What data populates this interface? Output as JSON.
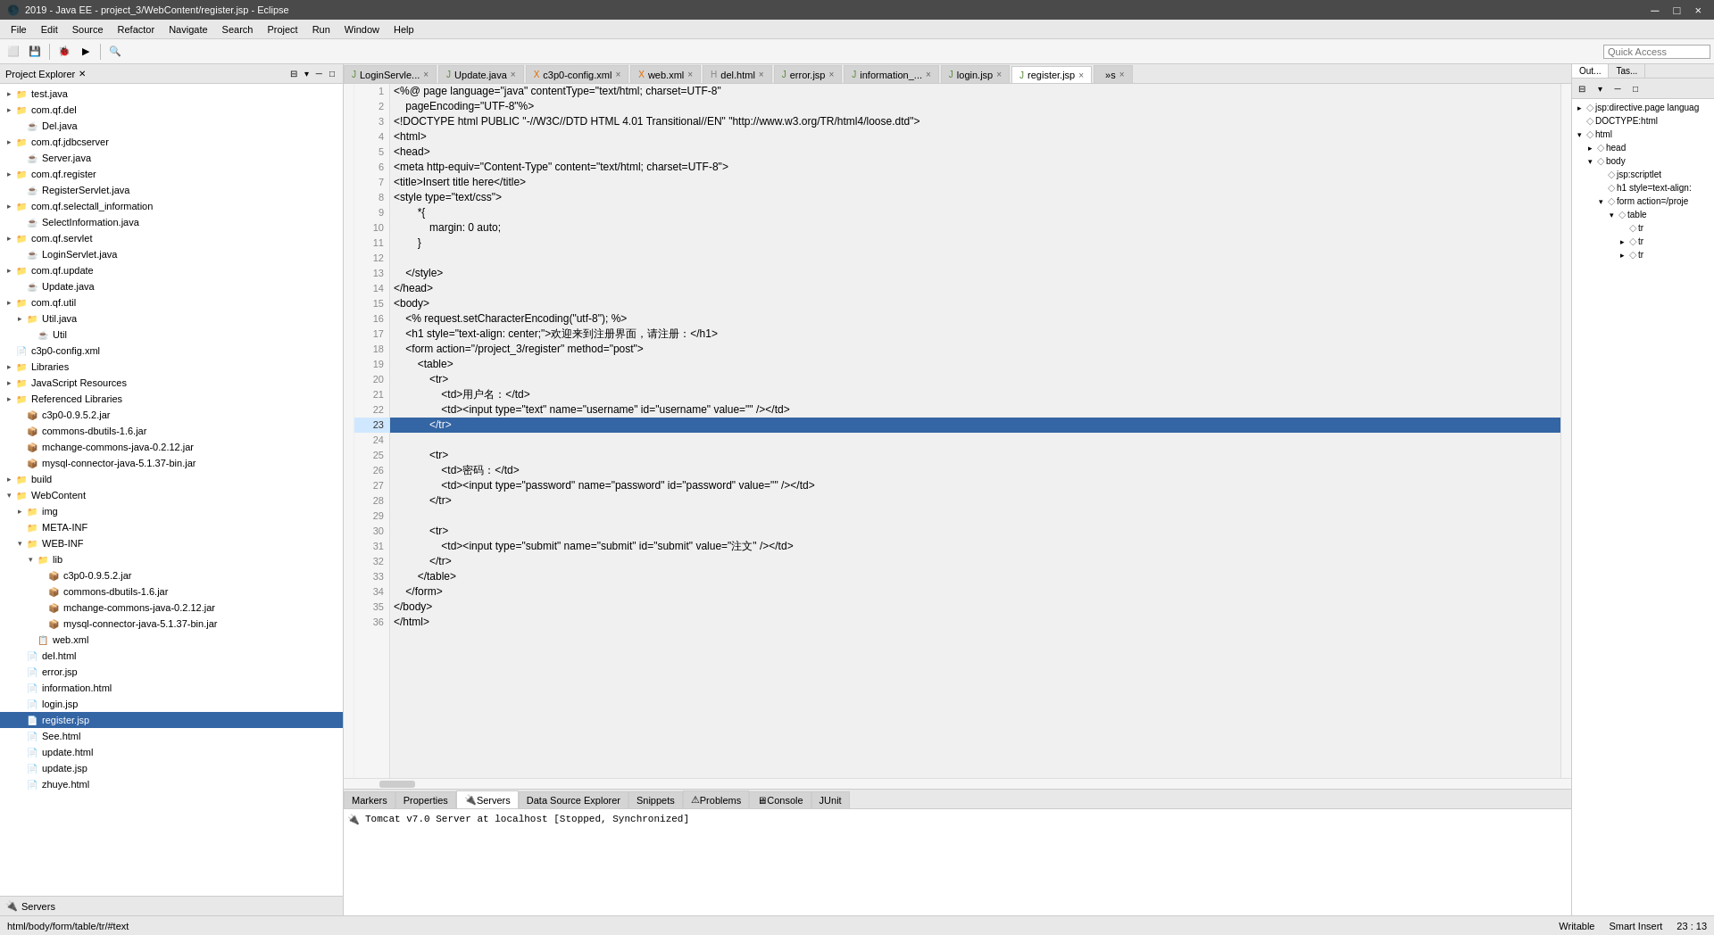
{
  "window": {
    "title": "2019 - Java EE - project_3/WebContent/register.jsp - Eclipse",
    "minimize": "─",
    "maximize": "□",
    "close": "×"
  },
  "menubar": {
    "items": [
      "File",
      "Edit",
      "Source",
      "Refactor",
      "Navigate",
      "Search",
      "Project",
      "Run",
      "Window",
      "Help"
    ]
  },
  "tabs": [
    {
      "label": "LoginServle...",
      "active": false,
      "icon": "J"
    },
    {
      "label": "Update.java",
      "active": false,
      "icon": "J"
    },
    {
      "label": "c3p0-config.xml",
      "active": false,
      "icon": "X"
    },
    {
      "label": "web.xml",
      "active": false,
      "icon": "X"
    },
    {
      "label": "del.html",
      "active": false,
      "icon": "H"
    },
    {
      "label": "error.jsp",
      "active": false,
      "icon": "J"
    },
    {
      "label": "information_...",
      "active": false,
      "icon": "J"
    },
    {
      "label": "login.jsp",
      "active": false,
      "icon": "J"
    },
    {
      "label": "register.jsp",
      "active": true,
      "icon": "J"
    },
    {
      "label": "»s",
      "active": false,
      "icon": ""
    }
  ],
  "code": {
    "lines": [
      {
        "num": 1,
        "content": "<%@ page language=\"java\" contentType=\"text/html; charset=UTF-8\"",
        "highlight": false
      },
      {
        "num": 2,
        "content": "    pageEncoding=\"UTF-8\"%>",
        "highlight": false
      },
      {
        "num": 3,
        "content": "<!DOCTYPE html PUBLIC \"-//W3C//DTD HTML 4.01 Transitional//EN\" \"http://www.w3.org/TR/html4/loose.dtd\">",
        "highlight": false
      },
      {
        "num": 4,
        "content": "<html>",
        "highlight": false
      },
      {
        "num": 5,
        "content": "<head>",
        "highlight": false
      },
      {
        "num": 6,
        "content": "<meta http-equiv=\"Content-Type\" content=\"text/html; charset=UTF-8\">",
        "highlight": false
      },
      {
        "num": 7,
        "content": "<title>Insert title here</title>",
        "highlight": false
      },
      {
        "num": 8,
        "content": "<style type=\"text/css\">",
        "highlight": false
      },
      {
        "num": 9,
        "content": "        *{",
        "highlight": false
      },
      {
        "num": 10,
        "content": "            margin: 0 auto;",
        "highlight": false
      },
      {
        "num": 11,
        "content": "        }",
        "highlight": false
      },
      {
        "num": 12,
        "content": "",
        "highlight": false
      },
      {
        "num": 13,
        "content": "    </style>",
        "highlight": false
      },
      {
        "num": 14,
        "content": "</head>",
        "highlight": false
      },
      {
        "num": 15,
        "content": "<body>",
        "highlight": false
      },
      {
        "num": 16,
        "content": "    <% request.setCharacterEncoding(\"utf-8\"); %>",
        "highlight": false
      },
      {
        "num": 17,
        "content": "    <h1 style=\"text-align: center;\">欢迎来到注册界面，请注册：</h1>",
        "highlight": false
      },
      {
        "num": 18,
        "content": "    <form action=\"/project_3/register\" method=\"post\">",
        "highlight": false
      },
      {
        "num": 19,
        "content": "        <table>",
        "highlight": false
      },
      {
        "num": 20,
        "content": "            <tr>",
        "highlight": false
      },
      {
        "num": 21,
        "content": "                <td>用户名：</td>",
        "highlight": false
      },
      {
        "num": 22,
        "content": "                <td><input type=\"text\" name=\"username\" id=\"username\" value=\"\" /></td>",
        "highlight": false
      },
      {
        "num": 23,
        "content": "            </tr>",
        "highlight": true
      },
      {
        "num": 24,
        "content": "",
        "highlight": false
      },
      {
        "num": 25,
        "content": "            <tr>",
        "highlight": false
      },
      {
        "num": 26,
        "content": "                <td>密码：</td>",
        "highlight": false
      },
      {
        "num": 27,
        "content": "                <td><input type=\"password\" name=\"password\" id=\"password\" value=\"\" /></td>",
        "highlight": false
      },
      {
        "num": 28,
        "content": "            </tr>",
        "highlight": false
      },
      {
        "num": 29,
        "content": "",
        "highlight": false
      },
      {
        "num": 30,
        "content": "            <tr>",
        "highlight": false
      },
      {
        "num": 31,
        "content": "                <td><input type=\"submit\" name=\"submit\" id=\"submit\" value=\"注文\" /></td>",
        "highlight": false
      },
      {
        "num": 32,
        "content": "            </tr>",
        "highlight": false
      },
      {
        "num": 33,
        "content": "        </table>",
        "highlight": false
      },
      {
        "num": 34,
        "content": "    </form>",
        "highlight": false
      },
      {
        "num": 35,
        "content": "</body>",
        "highlight": false
      },
      {
        "num": 36,
        "content": "</html>",
        "highlight": false
      }
    ]
  },
  "sidebar": {
    "title": "Project Explorer",
    "items": [
      {
        "indent": 0,
        "arrow": "▸",
        "icon": "folder",
        "label": "test.java",
        "depth": 2
      },
      {
        "indent": 0,
        "arrow": "▸",
        "icon": "folder",
        "label": "com.qf.del",
        "depth": 1
      },
      {
        "indent": 1,
        "arrow": "",
        "icon": "java",
        "label": "Del.java",
        "depth": 2
      },
      {
        "indent": 0,
        "arrow": "▸",
        "icon": "folder",
        "label": "com.qf.jdbcserver",
        "depth": 1
      },
      {
        "indent": 1,
        "arrow": "",
        "icon": "java",
        "label": "Server.java",
        "depth": 2
      },
      {
        "indent": 0,
        "arrow": "▸",
        "icon": "folder",
        "label": "com.qf.register",
        "depth": 1
      },
      {
        "indent": 1,
        "arrow": "",
        "icon": "java",
        "label": "RegisterServlet.java",
        "depth": 2
      },
      {
        "indent": 0,
        "arrow": "▸",
        "icon": "folder",
        "label": "com.qf.selectall_information",
        "depth": 1
      },
      {
        "indent": 1,
        "arrow": "",
        "icon": "java",
        "label": "SelectInformation.java",
        "depth": 2
      },
      {
        "indent": 0,
        "arrow": "▸",
        "icon": "folder",
        "label": "com.qf.servlet",
        "depth": 1
      },
      {
        "indent": 1,
        "arrow": "",
        "icon": "java",
        "label": "LoginServlet.java",
        "depth": 2
      },
      {
        "indent": 0,
        "arrow": "▸",
        "icon": "folder",
        "label": "com.qf.update",
        "depth": 1
      },
      {
        "indent": 1,
        "arrow": "",
        "icon": "java",
        "label": "Update.java",
        "depth": 2
      },
      {
        "indent": 0,
        "arrow": "▸",
        "icon": "folder",
        "label": "com.qf.util",
        "depth": 1
      },
      {
        "indent": 1,
        "arrow": "▸",
        "icon": "folder",
        "label": "Util.java",
        "depth": 2
      },
      {
        "indent": 2,
        "arrow": "",
        "icon": "java",
        "label": "Util",
        "depth": 3
      },
      {
        "indent": 0,
        "arrow": "",
        "icon": "file",
        "label": "c3p0-config.xml",
        "depth": 1
      },
      {
        "indent": 0,
        "arrow": "▸",
        "icon": "folder",
        "label": "Libraries",
        "depth": 0
      },
      {
        "indent": 0,
        "arrow": "▸",
        "icon": "folder",
        "label": "JavaScript Resources",
        "depth": 0
      },
      {
        "indent": 0,
        "arrow": "▸",
        "icon": "folder",
        "label": "Referenced Libraries",
        "depth": 0
      },
      {
        "indent": 1,
        "arrow": "",
        "icon": "jar",
        "label": "c3p0-0.9.5.2.jar",
        "depth": 1
      },
      {
        "indent": 1,
        "arrow": "",
        "icon": "jar",
        "label": "commons-dbutils-1.6.jar",
        "depth": 1
      },
      {
        "indent": 1,
        "arrow": "",
        "icon": "jar",
        "label": "mchange-commons-java-0.2.12.jar",
        "depth": 1
      },
      {
        "indent": 1,
        "arrow": "",
        "icon": "jar",
        "label": "mysql-connector-java-5.1.37-bin.jar",
        "depth": 1
      },
      {
        "indent": 0,
        "arrow": "▸",
        "icon": "folder",
        "label": "build",
        "depth": 0
      },
      {
        "indent": 0,
        "arrow": "▾",
        "icon": "folder",
        "label": "WebContent",
        "depth": 0
      },
      {
        "indent": 1,
        "arrow": "▸",
        "icon": "folder",
        "label": "img",
        "depth": 1
      },
      {
        "indent": 1,
        "arrow": "",
        "icon": "folder",
        "label": "META-INF",
        "depth": 1
      },
      {
        "indent": 1,
        "arrow": "▾",
        "icon": "folder",
        "label": "WEB-INF",
        "depth": 1
      },
      {
        "indent": 2,
        "arrow": "▾",
        "icon": "folder",
        "label": "lib",
        "depth": 2
      },
      {
        "indent": 3,
        "arrow": "",
        "icon": "jar",
        "label": "c3p0-0.9.5.2.jar",
        "depth": 3
      },
      {
        "indent": 3,
        "arrow": "",
        "icon": "jar",
        "label": "commons-dbutils-1.6.jar",
        "depth": 3
      },
      {
        "indent": 3,
        "arrow": "",
        "icon": "jar",
        "label": "mchange-commons-java-0.2.12.jar",
        "depth": 3
      },
      {
        "indent": 3,
        "arrow": "",
        "icon": "jar",
        "label": "mysql-connector-java-5.1.37-bin.jar",
        "depth": 3
      },
      {
        "indent": 2,
        "arrow": "",
        "icon": "xml",
        "label": "web.xml",
        "depth": 2
      },
      {
        "indent": 1,
        "arrow": "",
        "icon": "file",
        "label": "del.html",
        "depth": 1
      },
      {
        "indent": 1,
        "arrow": "",
        "icon": "file",
        "label": "error.jsp",
        "depth": 1
      },
      {
        "indent": 1,
        "arrow": "",
        "icon": "file",
        "label": "information.html",
        "depth": 1
      },
      {
        "indent": 1,
        "arrow": "",
        "icon": "file",
        "label": "login.jsp",
        "depth": 1
      },
      {
        "indent": 1,
        "arrow": "",
        "icon": "file",
        "label": "register.jsp",
        "depth": 1,
        "selected": true
      },
      {
        "indent": 1,
        "arrow": "",
        "icon": "file",
        "label": "See.html",
        "depth": 1
      },
      {
        "indent": 1,
        "arrow": "",
        "icon": "file",
        "label": "update.html",
        "depth": 1
      },
      {
        "indent": 1,
        "arrow": "",
        "icon": "file",
        "label": "update.jsp",
        "depth": 1
      },
      {
        "indent": 1,
        "arrow": "",
        "icon": "file",
        "label": "zhuye.html",
        "depth": 1
      }
    ]
  },
  "bottom_sidebar": {
    "label": "Servers"
  },
  "right_panel": {
    "tabs": [
      "Out...",
      "Tas..."
    ],
    "outline_items": [
      {
        "indent": 0,
        "arrow": "▸",
        "icon": "tag",
        "label": "jsp:directive.page languag"
      },
      {
        "indent": 0,
        "arrow": "",
        "icon": "tag",
        "label": "DOCTYPE:html"
      },
      {
        "indent": 0,
        "arrow": "▾",
        "icon": "tag",
        "label": "html"
      },
      {
        "indent": 1,
        "arrow": "▸",
        "icon": "tag",
        "label": "head"
      },
      {
        "indent": 1,
        "arrow": "▾",
        "icon": "tag",
        "label": "body"
      },
      {
        "indent": 2,
        "arrow": "",
        "icon": "tag",
        "label": "jsp:scriptlet"
      },
      {
        "indent": 2,
        "arrow": "",
        "icon": "tag",
        "label": "h1 style=text-align:"
      },
      {
        "indent": 2,
        "arrow": "▾",
        "icon": "tag",
        "label": "form action=/proje"
      },
      {
        "indent": 3,
        "arrow": "▾",
        "icon": "tag",
        "label": "table"
      },
      {
        "indent": 4,
        "arrow": "",
        "icon": "tag",
        "label": "tr"
      },
      {
        "indent": 4,
        "arrow": "▸",
        "icon": "tag",
        "label": "tr"
      },
      {
        "indent": 4,
        "arrow": "▸",
        "icon": "tag",
        "label": "tr"
      }
    ]
  },
  "bottom_panel": {
    "tabs": [
      "Markers",
      "Properties",
      "Servers",
      "Data Source Explorer",
      "Snippets",
      "Problems",
      "Console",
      "JUnit"
    ],
    "active_tab": "Servers",
    "console_content": "Tomcat v7.0 Server at localhost  [Stopped, Synchronized]"
  },
  "status_bar": {
    "path": "html/body/form/table/tr/#text",
    "mode": "Writable",
    "insert_mode": "Smart Insert",
    "position": "23 : 13"
  },
  "quick_access": {
    "placeholder": "Quick Access"
  }
}
